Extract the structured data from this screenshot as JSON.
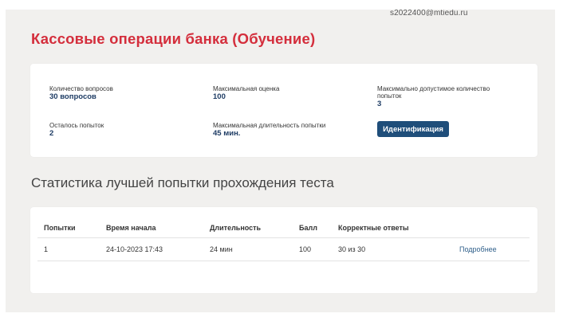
{
  "header": {
    "email": "s2022400@mtiedu.ru"
  },
  "page_title": "Кассовые операции банка (Обучение)",
  "info": {
    "questions_label": "Количество вопросов",
    "questions_value": "30 вопросов",
    "max_score_label": "Максимальная оценка",
    "max_score_value": "100",
    "max_attempts_label": "Максимально допустимое количество попыток",
    "max_attempts_value": "3",
    "attempts_left_label": "Осталось попыток",
    "attempts_left_value": "2",
    "max_duration_label": "Максимальная длительность попытки",
    "max_duration_value": "45 мин.",
    "identify_button": "Идентификация"
  },
  "stats": {
    "title": "Статистика лучшей попытки прохождения теста",
    "columns": [
      "Попытки",
      "Время начала",
      "Длительность",
      "Балл",
      "Корректные ответы",
      ""
    ],
    "rows": [
      {
        "attempt": "1",
        "start_time": "24-10-2023 17:43",
        "duration": "24 мин",
        "score": "100",
        "correct": "30 из 30",
        "link": "Подробнее"
      }
    ]
  }
}
